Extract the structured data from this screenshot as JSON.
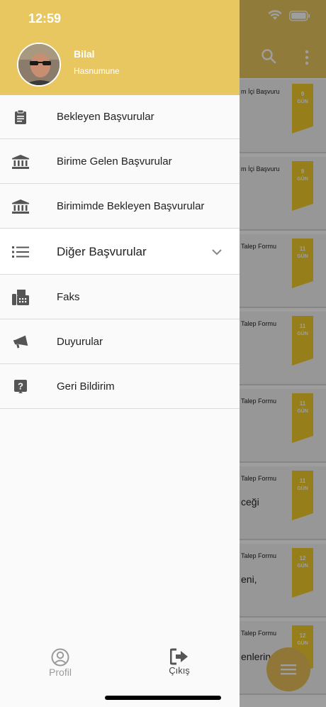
{
  "status_bar": {
    "time": "12:59"
  },
  "user": {
    "name": "Bilal",
    "subtitle": "Hasnumune"
  },
  "menu": [
    {
      "label": "Bekleyen Başvurular",
      "icon": "clipboard-icon"
    },
    {
      "label": "Birime Gelen Başvurular",
      "icon": "bank-icon"
    },
    {
      "label": "Birimimde Bekleyen Başvurular",
      "icon": "bank-icon"
    },
    {
      "label": "Diğer Başvurular",
      "icon": "list-icon",
      "expandable": true
    },
    {
      "label": "Faks",
      "icon": "fax-icon"
    },
    {
      "label": "Duyurular",
      "icon": "megaphone-icon"
    },
    {
      "label": "Geri Bildirim",
      "icon": "question-icon"
    }
  ],
  "bottom_bar": {
    "profile_label": "Profil",
    "exit_label": "Çıkış"
  },
  "background_cards": [
    {
      "title": "m İçi Başvuru",
      "sub": "",
      "num": "9",
      "unit": "GÜN"
    },
    {
      "title": "m İçi Başvuru",
      "sub": "",
      "num": "9",
      "unit": "GÜN"
    },
    {
      "title": "Talep Formu",
      "sub": "",
      "num": "11",
      "unit": "GÜN"
    },
    {
      "title": "Talep Formu",
      "sub": "",
      "num": "11",
      "unit": "GÜN"
    },
    {
      "title": "Talep Formu",
      "sub": "",
      "num": "11",
      "unit": "GÜN"
    },
    {
      "title": "Talep Formu",
      "sub": "ceği",
      "num": "11",
      "unit": "GÜN"
    },
    {
      "title": "Talep Formu",
      "sub": "eni,",
      "num": "12",
      "unit": "GÜN"
    },
    {
      "title": "Talep Formu",
      "sub": "enlerin",
      "num": "12",
      "unit": "GÜN"
    }
  ],
  "colors": {
    "header": "#e8c760",
    "flag": "#f2cd2d",
    "fab": "#e8c15a"
  }
}
